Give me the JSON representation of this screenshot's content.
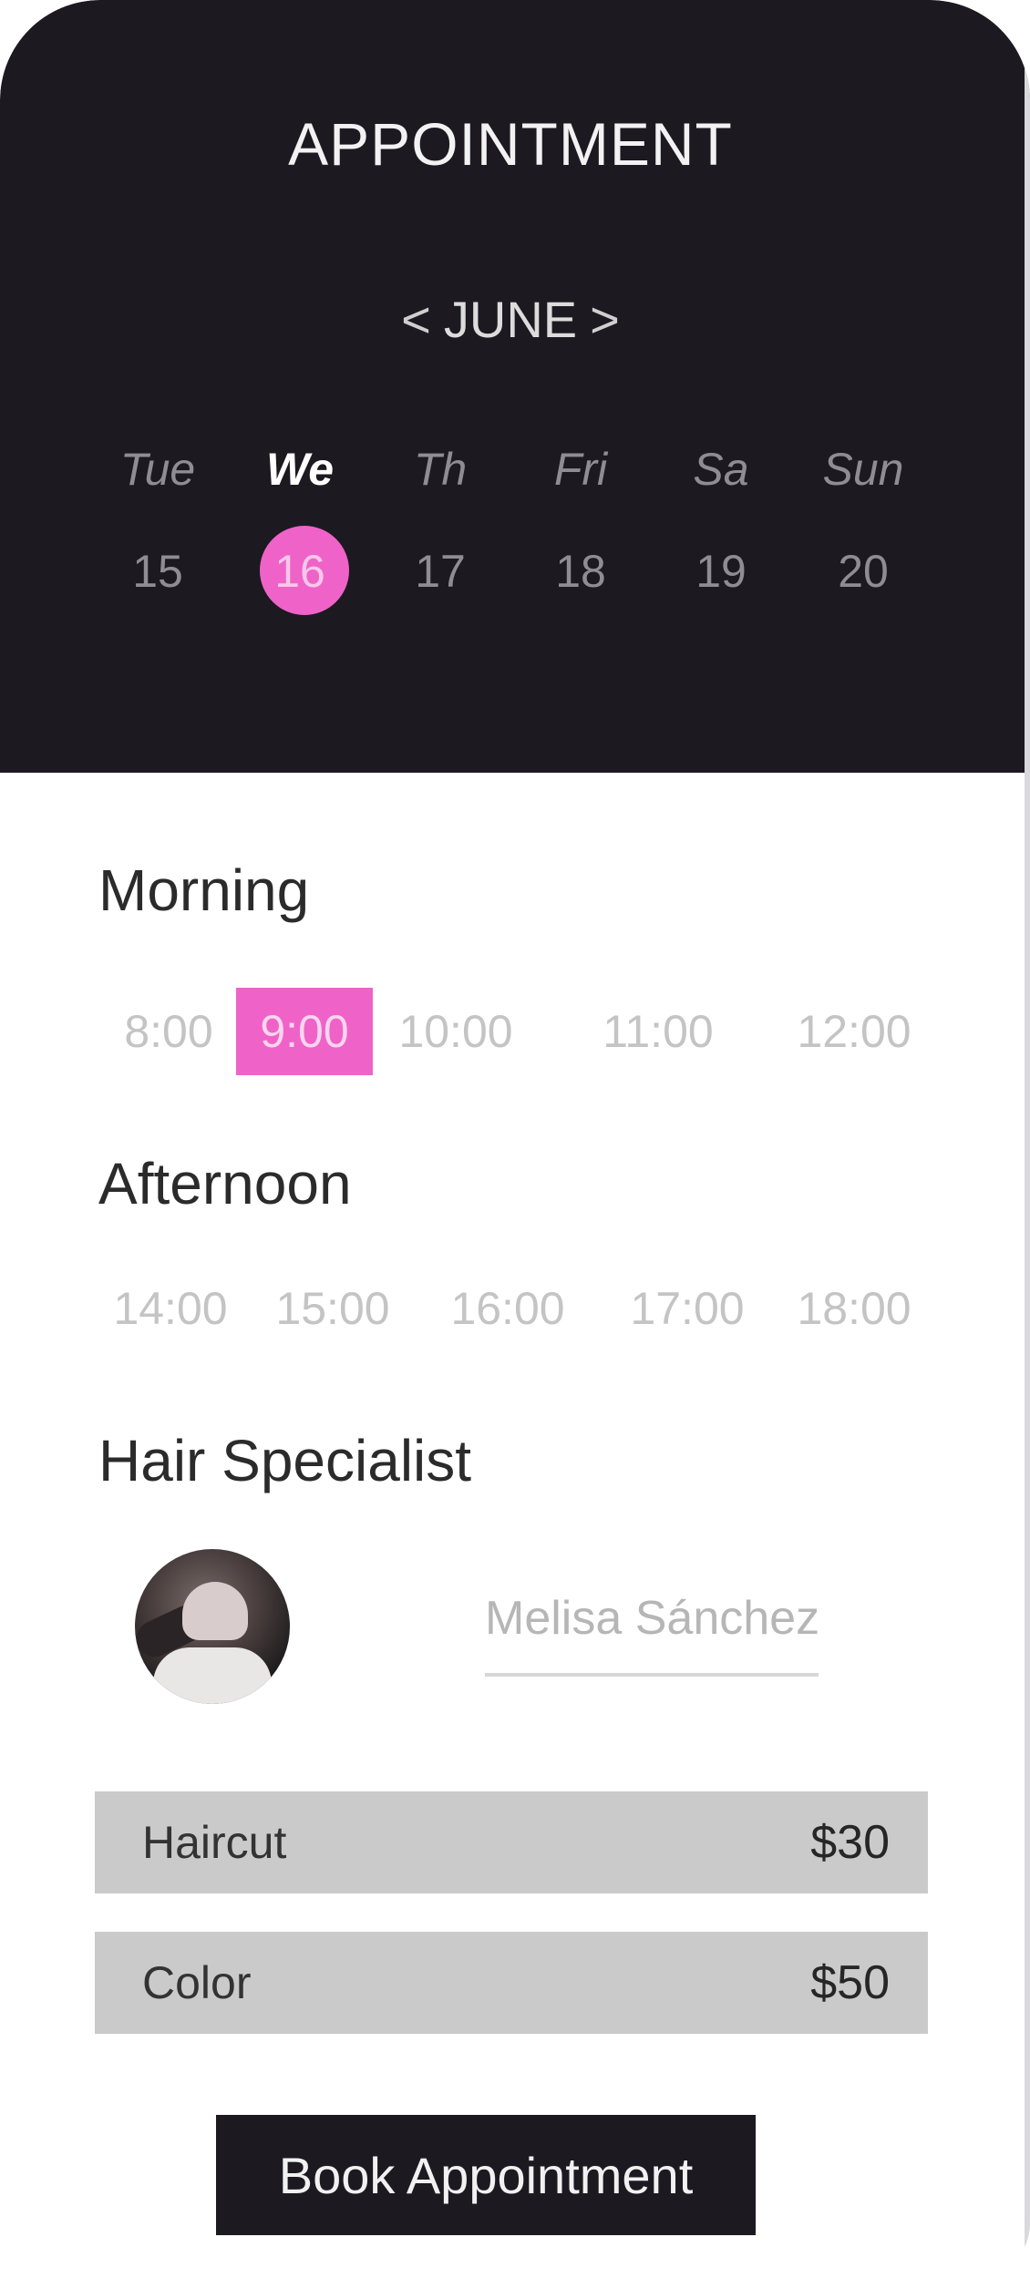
{
  "header": {
    "title": "APPOINTMENT",
    "month": "JUNE",
    "prev_icon": "<",
    "next_icon": ">"
  },
  "calendar": {
    "days": [
      {
        "name": "Tue",
        "number": "15"
      },
      {
        "name": "We",
        "number": "16"
      },
      {
        "name": "Th",
        "number": "17"
      },
      {
        "name": "Fri",
        "number": "18"
      },
      {
        "name": "Sa",
        "number": "19"
      },
      {
        "name": "Sun",
        "number": "20"
      }
    ],
    "selected_day": "16"
  },
  "morning": {
    "title": "Morning",
    "slots": [
      "8:00",
      "9:00",
      "10:00",
      "11:00",
      "12:00"
    ],
    "selected": "9:00"
  },
  "afternoon": {
    "title": "Afternoon",
    "slots": [
      "14:00",
      "15:00",
      "16:00",
      "17:00",
      "18:00"
    ]
  },
  "specialist": {
    "title": "Hair Specialist",
    "name": "Melisa Sánchez"
  },
  "services": [
    {
      "label": "Haircut",
      "price": "$30"
    },
    {
      "label": "Color",
      "price": "$50"
    }
  ],
  "actions": {
    "book_label": "Book Appointment"
  },
  "colors": {
    "accent": "#ef63c8",
    "header_bg": "#1c1920",
    "service_bg": "#cacaca"
  }
}
